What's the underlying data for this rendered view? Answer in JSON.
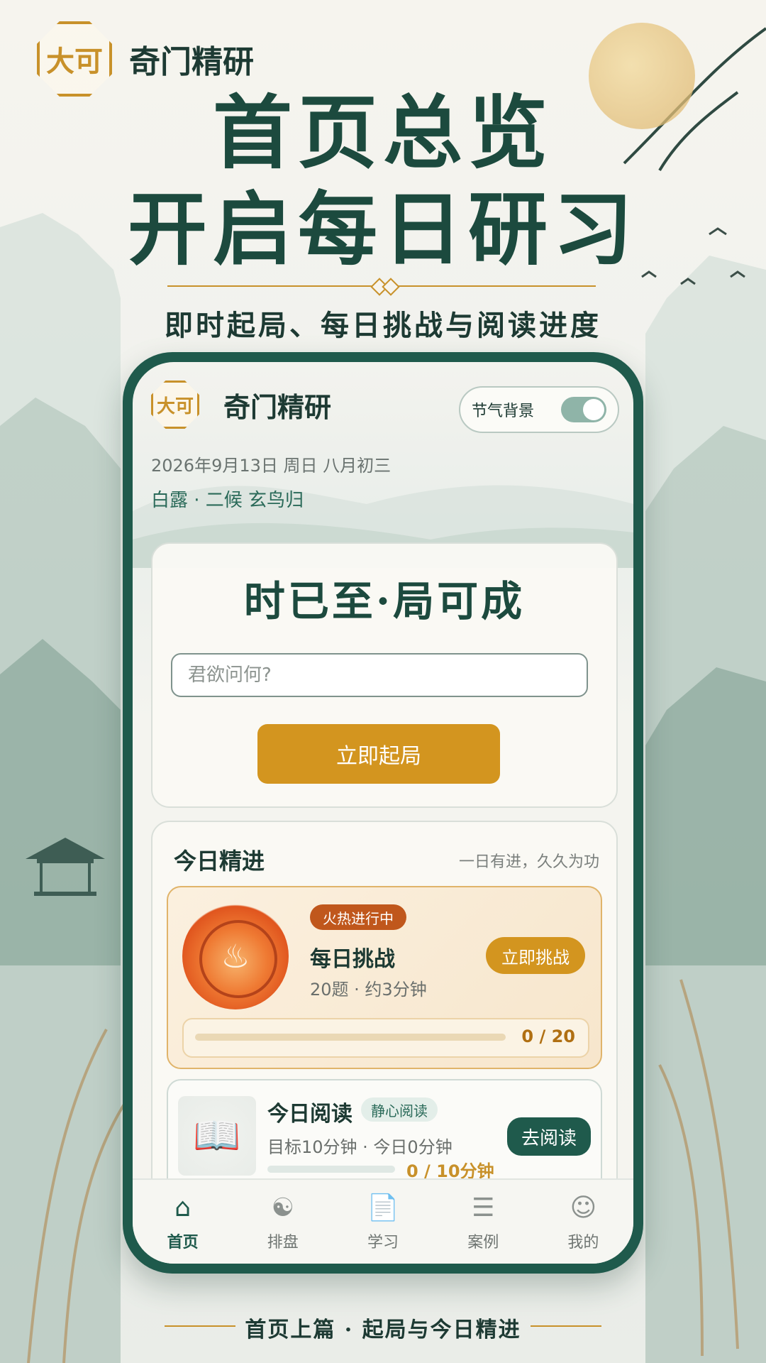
{
  "poster": {
    "brand_seal": "大可",
    "brand_name": "奇门精研",
    "headline_1": "首页总览",
    "headline_2": "开启每日研习",
    "subtitle": "即时起局、每日挑战与阅读进度",
    "footer_caption": "首页上篇 · 起局与今日精进"
  },
  "app": {
    "seal": "大可",
    "name": "奇门精研",
    "toggle": {
      "label": "节气背景",
      "on": true
    },
    "date": "2026年9月13日  周日  八月初三",
    "solar_term": "白露 · 二候  玄鸟归",
    "hero": {
      "slogan": "时已至·局可成",
      "input_placeholder": "君欲问何?",
      "button": "立即起局"
    },
    "daily": {
      "title": "今日精进",
      "motto": "一日有进，久久为功",
      "challenge": {
        "badge": "火热进行中",
        "title": "每日挑战",
        "meta": "20题 · 约3分钟",
        "button": "立即挑战",
        "progress_done": 0,
        "progress_total": 20,
        "progress_text": "0 / 20"
      },
      "reading": {
        "title": "今日阅读",
        "tag": "静心阅读",
        "meta": "目标10分钟 · 今日0分钟",
        "progress_fraction": 0,
        "progress_text": "0 / 10分钟",
        "button": "去阅读"
      }
    },
    "tabs": [
      {
        "label": "首页",
        "icon": "home-icon",
        "active": true
      },
      {
        "label": "排盘",
        "icon": "bagua-icon",
        "active": false
      },
      {
        "label": "学习",
        "icon": "document-icon",
        "active": false
      },
      {
        "label": "案例",
        "icon": "case-icon",
        "active": false
      },
      {
        "label": "我的",
        "icon": "user-icon",
        "active": false
      }
    ]
  },
  "colors": {
    "primary_green": "#1f5a4c",
    "accent_gold": "#d3951f",
    "fire_orange": "#e0551e"
  }
}
